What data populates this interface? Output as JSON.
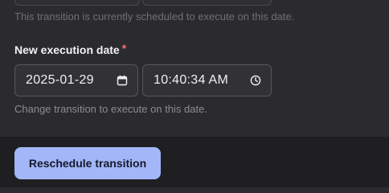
{
  "previous": {
    "help_text": "This transition is currently scheduled to execute on this date."
  },
  "new_date": {
    "label": "New execution date",
    "required_marker": "*",
    "date_value": "2025-01-29",
    "time_value": "10:40:34 AM",
    "help_text": "Change transition to execute on this date."
  },
  "footer": {
    "submit_label": "Reschedule transition"
  },
  "icons": {
    "date": "calendar-icon",
    "time": "clock-icon"
  },
  "colors": {
    "background": "#2b2b2f",
    "footer": "#1f1f22",
    "accent_button": "#a3b6f7",
    "required": "#ff6b6b"
  }
}
